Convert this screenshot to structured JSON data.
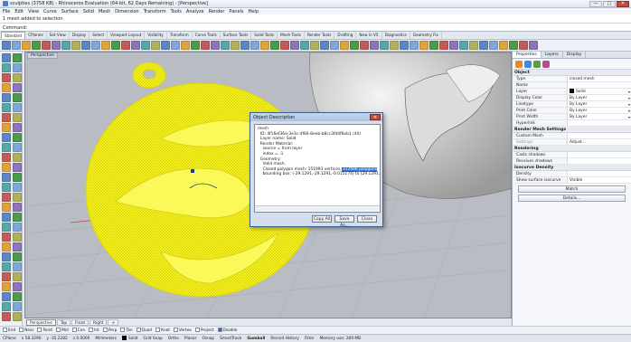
{
  "window": {
    "title": "sculpties (3758 KB) - Rhinoceros Evaluation (64-bit, 62 Days Remaining) - [Perspective]",
    "controls": [
      "—",
      "□",
      "✕"
    ]
  },
  "menu": [
    "File",
    "Edit",
    "View",
    "Curve",
    "Surface",
    "Solid",
    "Mesh",
    "Dimension",
    "Transform",
    "Tools",
    "Analyze",
    "Render",
    "Panels",
    "Help"
  ],
  "command": {
    "history": "1 mesh added to selection.",
    "prompt": "Command:",
    "value": ""
  },
  "tabs": [
    "Standard",
    "CPlanes",
    "Set View",
    "Display",
    "Select",
    "Viewport Layout",
    "Visibility",
    "Transform",
    "Curve Tools",
    "Surface Tools",
    "Solid Tools",
    "Mesh Tools",
    "Render Tools",
    "Drafting",
    "New in V5",
    "Diagnostics",
    "Geometry Fix"
  ],
  "viewport": {
    "label": "Perspective",
    "background": "#b9bdc3",
    "mesh_color": "#f7f21a"
  },
  "dialog": {
    "title": "Object Description",
    "lines": [
      "mesh",
      "  ID: 4f16ef36a-3e3c-4f84-8eeb-b8cc3fd4f6eb1 (40)",
      "  Layer name: Solid",
      "  Render Material:",
      "    source = from layer",
      "    index = -1",
      "  Geometry:",
      "    Valid mesh.",
      "    Closed polygon mesh: 151993 vertices,",
      "    bounding box: (-29.1291,-29.1291,-0.015174) to (29.1291,36.15"
    ],
    "highlight": "312688 polygons",
    "buttons": [
      "Copy All",
      "Save As...",
      "Close"
    ]
  },
  "view_tabs": [
    "Perspective",
    "Top",
    "Front",
    "Right",
    "+"
  ],
  "osnaps": [
    {
      "label": "End",
      "on": false
    },
    {
      "label": "Near",
      "on": false
    },
    {
      "label": "Point",
      "on": false
    },
    {
      "label": "Mid",
      "on": false
    },
    {
      "label": "Cen",
      "on": false
    },
    {
      "label": "Int",
      "on": false
    },
    {
      "label": "Perp",
      "on": false
    },
    {
      "label": "Tan",
      "on": false
    },
    {
      "label": "Quad",
      "on": false
    },
    {
      "label": "Knot",
      "on": false
    },
    {
      "label": "Vertex",
      "on": false
    },
    {
      "label": "Project",
      "on": false
    },
    {
      "label": "Disable",
      "on": true
    }
  ],
  "status": {
    "cplane": "CPlane",
    "x": "x 58.3290",
    "y": "y -35.2282",
    "z": "z 0.0000",
    "units": "Millimeters",
    "layer": "Solid",
    "toggles": [
      "Grid Snap",
      "Ortho",
      "Planar",
      "Osnap",
      "SmartTrack",
      "Gumball",
      "Record History",
      "Filter"
    ],
    "memory": "Memory use: 269 MB"
  },
  "panel": {
    "tabs": [
      "Properties",
      "Layers",
      "Display"
    ],
    "object_header": "Object",
    "rows": [
      {
        "k": "Type",
        "v": "closed mesh"
      },
      {
        "k": "Name",
        "v": ""
      },
      {
        "k": "Layer",
        "v": "Solid",
        "swatch": "#000000"
      },
      {
        "k": "Display Color",
        "v": "By Layer"
      },
      {
        "k": "Linetype",
        "v": "By Layer"
      },
      {
        "k": "Print Color",
        "v": "By Layer"
      },
      {
        "k": "Print Width",
        "v": "By Layer"
      },
      {
        "k": "Hyperlink",
        "v": ""
      }
    ],
    "render_mesh_header": "Render Mesh Settings",
    "render_mesh_rows": [
      {
        "k": "Custom Mesh",
        "v": ""
      },
      {
        "k": "Settings",
        "v": "Adjust..."
      }
    ],
    "rendering_header": "Rendering",
    "rendering_rows": [
      {
        "k": "Casts shadows",
        "v": ""
      },
      {
        "k": "Receives shadows",
        "v": ""
      }
    ],
    "isocurve_header": "Isocurve Density",
    "isocurve_rows": [
      {
        "k": "Density",
        "v": ""
      },
      {
        "k": "Show surface isocurve",
        "v": "Visible"
      }
    ],
    "buttons": [
      "Match",
      "Details..."
    ]
  }
}
